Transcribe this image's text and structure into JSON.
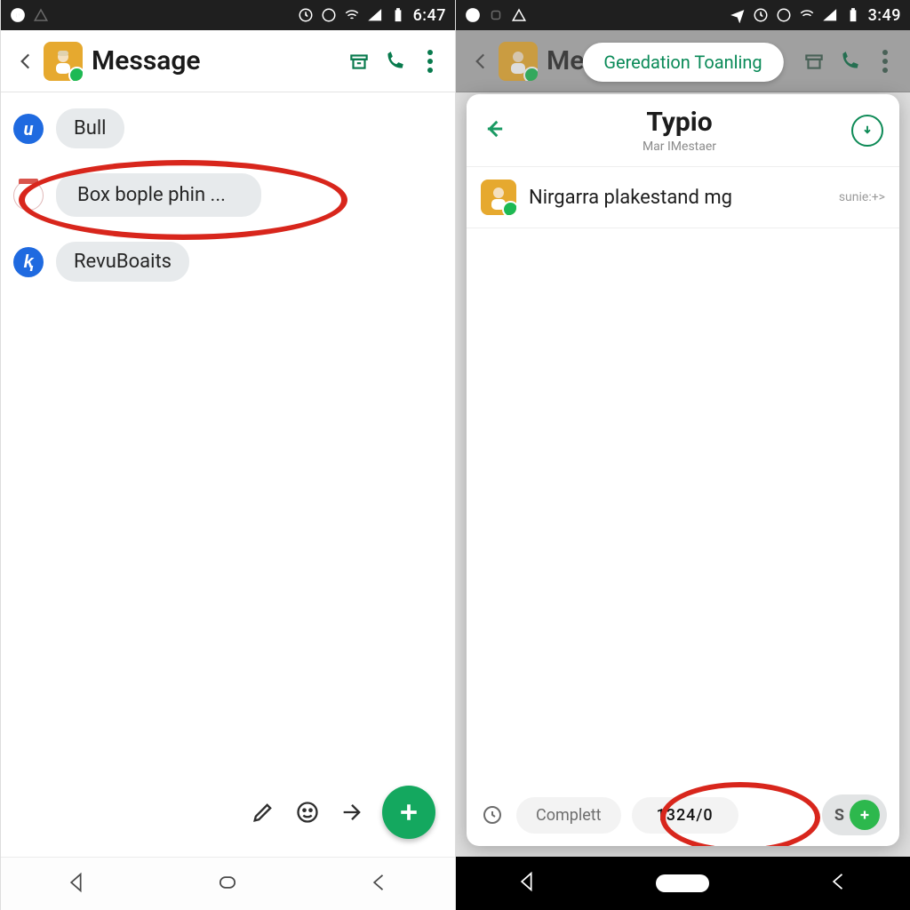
{
  "left": {
    "status_time": "6:47",
    "header_title": "Message",
    "messages": [
      {
        "avatar_badge": "u",
        "avatar_class": "ava-blue",
        "text": "Bull"
      },
      {
        "avatar_badge": "📅",
        "avatar_class": "ava-cal",
        "text": "Box bople phin ...",
        "highlighted": true
      },
      {
        "avatar_badge": "ⱪ",
        "avatar_class": "ava-blue",
        "text": "RevuBoaits"
      }
    ]
  },
  "right": {
    "status_time": "3:49",
    "header_title": "Mess",
    "tooltip": "Geredation Toanling",
    "card": {
      "title": "Typio",
      "subtitle": "Mar IMestaer",
      "row_text": "Nirgarra plakestand mg",
      "row_meta": "sunie:+>",
      "foot_label": "Complett",
      "foot_value": "1324/0",
      "foot_s": "S"
    }
  }
}
